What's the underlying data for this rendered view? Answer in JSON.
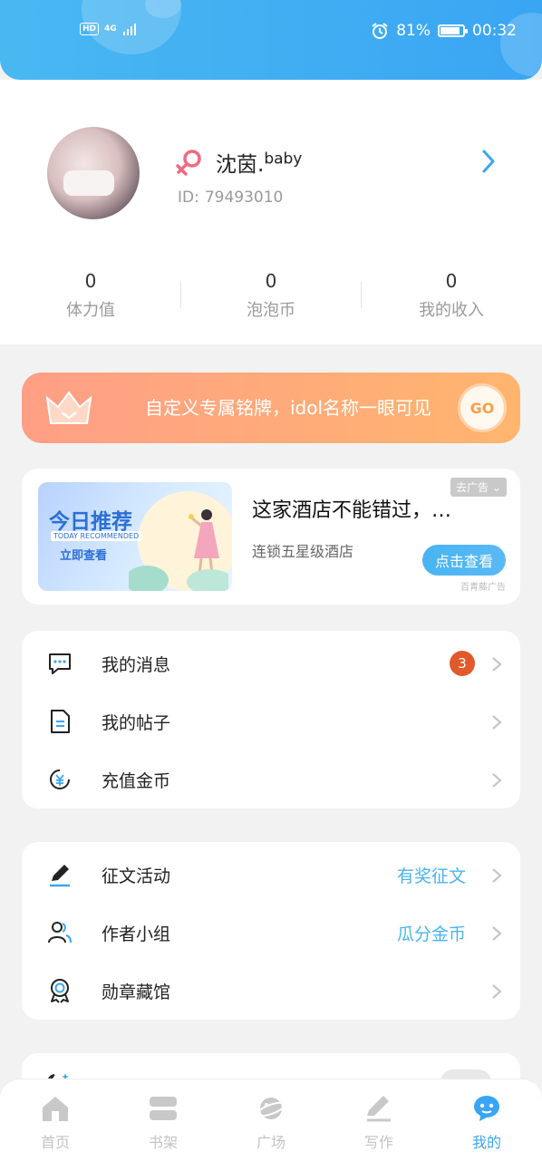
{
  "status_bar": {
    "hd": "HD",
    "network": "4G",
    "battery_percent": "81%",
    "battery_level": 0.81,
    "time": "00:32"
  },
  "profile": {
    "name": "沈茵.",
    "name_suffix": "baby",
    "id_label": "ID:",
    "id_value": "79493010",
    "gender_color": "#f06a80"
  },
  "stats": [
    {
      "value": "0",
      "label": "体力值"
    },
    {
      "value": "0",
      "label": "泡泡币"
    },
    {
      "value": "0",
      "label": "我的收入"
    }
  ],
  "banner": {
    "text": "自定义专属铭牌，idol名称一眼可见",
    "go_label": "GO"
  },
  "ad": {
    "image_title": "今日推荐",
    "image_subtitle": "TODAY RECOMMENDED",
    "image_button": "立即查看",
    "title": "这家酒店不能错过，…",
    "description": "连锁五星级酒店",
    "remove_ad": "去广告",
    "cta": "点击查看",
    "source": "百青藤广告"
  },
  "menu_group_1": [
    {
      "label": "我的消息",
      "icon": "message-icon",
      "badge": "3"
    },
    {
      "label": "我的帖子",
      "icon": "document-icon"
    },
    {
      "label": "充值金币",
      "icon": "yuan-coin-icon"
    }
  ],
  "menu_group_2": [
    {
      "label": "征文活动",
      "icon": "pen-icon",
      "extra": "有奖征文"
    },
    {
      "label": "作者小组",
      "icon": "users-icon",
      "extra": "瓜分金币"
    },
    {
      "label": "勋章藏馆",
      "icon": "medal-icon"
    }
  ],
  "tabs": [
    {
      "label": "首页",
      "icon": "home-icon",
      "active": false
    },
    {
      "label": "书架",
      "icon": "bookshelf-icon",
      "active": false
    },
    {
      "label": "广场",
      "icon": "planet-icon",
      "active": false
    },
    {
      "label": "写作",
      "icon": "write-icon",
      "active": false
    },
    {
      "label": "我的",
      "icon": "profile-bubble-icon",
      "active": true
    }
  ],
  "colors": {
    "accent": "#3aa5f3",
    "badge": "#e05a2c",
    "banner_start": "#ff9f86",
    "banner_end": "#ffb56e",
    "inactive_tab": "#c3c3c3"
  }
}
